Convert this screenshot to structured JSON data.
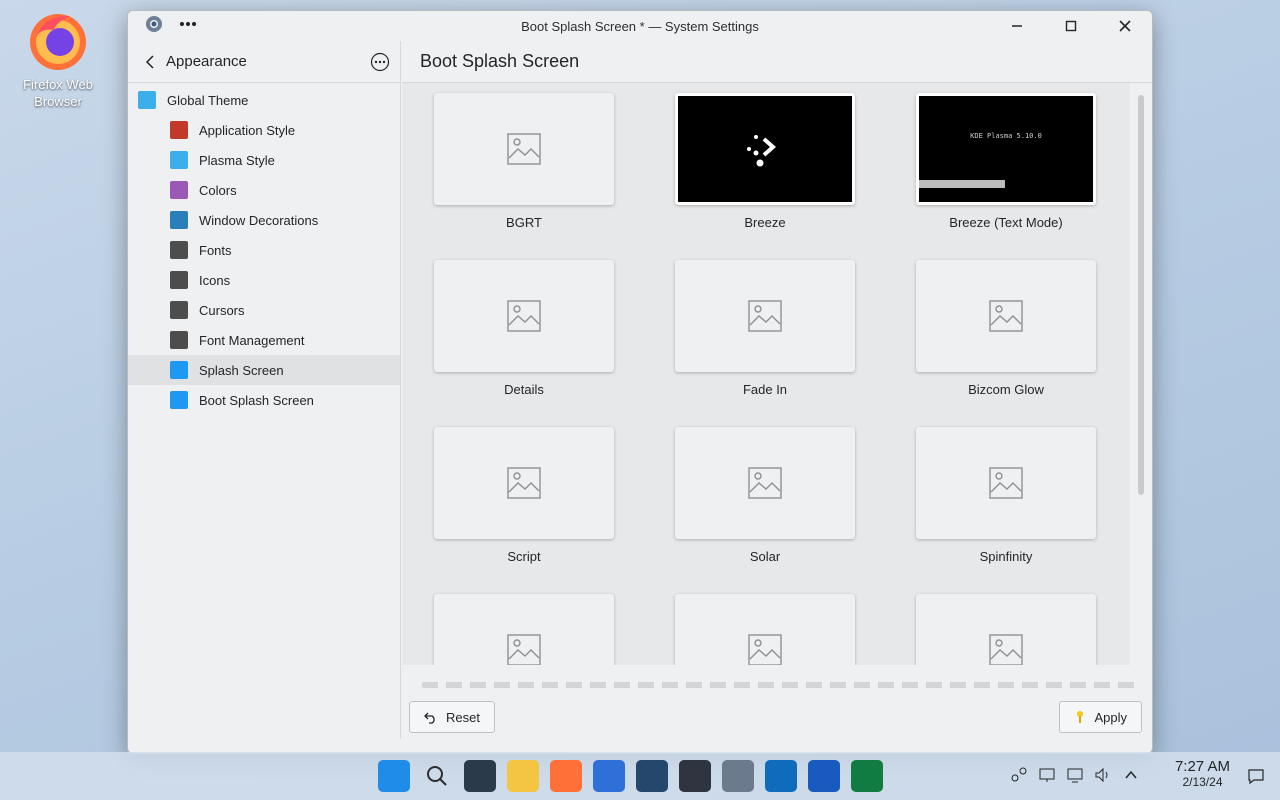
{
  "desktop": {
    "icon_label": "Firefox Web Browser"
  },
  "window": {
    "title": "Boot Splash Screen * — System Settings"
  },
  "sidebar": {
    "back_label": "Appearance",
    "items": [
      {
        "label": "Global Theme",
        "icon": "global-theme-icon",
        "level": "top",
        "color": "#3daee9"
      },
      {
        "label": "Application Style",
        "icon": "application-style-icon",
        "level": "sub",
        "color": "#c0392b"
      },
      {
        "label": "Plasma Style",
        "icon": "plasma-style-icon",
        "level": "sub",
        "color": "#3daee9"
      },
      {
        "label": "Colors",
        "icon": "colors-icon",
        "level": "sub",
        "color": "#9b59b6"
      },
      {
        "label": "Window Decorations",
        "icon": "window-decorations-icon",
        "level": "sub",
        "color": "#2980b9"
      },
      {
        "label": "Fonts",
        "icon": "fonts-icon",
        "level": "sub",
        "color": "#4d4d4d"
      },
      {
        "label": "Icons",
        "icon": "icons-icon",
        "level": "sub",
        "color": "#4d4d4d"
      },
      {
        "label": "Cursors",
        "icon": "cursors-icon",
        "level": "sub",
        "color": "#4d4d4d"
      },
      {
        "label": "Font Management",
        "icon": "font-management-icon",
        "level": "sub",
        "color": "#4d4d4d"
      },
      {
        "label": "Splash Screen",
        "icon": "splash-screen-icon",
        "level": "sub",
        "color": "#1d99f3",
        "selected": true
      },
      {
        "label": "Boot Splash Screen",
        "icon": "boot-splash-screen-icon",
        "level": "sub",
        "color": "#1d99f3"
      }
    ]
  },
  "main": {
    "title": "Boot Splash Screen",
    "themes": [
      {
        "name": "BGRT",
        "preview": "placeholder"
      },
      {
        "name": "Breeze",
        "preview": "breeze"
      },
      {
        "name": "Breeze (Text Mode)",
        "preview": "text",
        "preview_text": "KDE Plasma 5.10.0"
      },
      {
        "name": "Details",
        "preview": "placeholder"
      },
      {
        "name": "Fade In",
        "preview": "placeholder"
      },
      {
        "name": "Bizcom Glow",
        "preview": "placeholder"
      },
      {
        "name": "Script",
        "preview": "placeholder"
      },
      {
        "name": "Solar",
        "preview": "placeholder"
      },
      {
        "name": "Spinfinity",
        "preview": "placeholder"
      },
      {
        "name": "",
        "preview": "placeholder"
      },
      {
        "name": "",
        "preview": "placeholder"
      },
      {
        "name": "",
        "preview": "placeholder"
      }
    ]
  },
  "footer": {
    "reset_label": "Reset",
    "apply_label": "Apply"
  },
  "taskbar": {
    "apps": [
      "start-icon",
      "search-icon",
      "task-view-icon",
      "file-explorer-icon",
      "firefox-icon",
      "store-icon",
      "photos-icon",
      "terminal-icon",
      "settings-icon",
      "outlook-icon",
      "word-icon",
      "excel-icon"
    ],
    "time": "7:27 AM",
    "date": "2/13/24"
  }
}
